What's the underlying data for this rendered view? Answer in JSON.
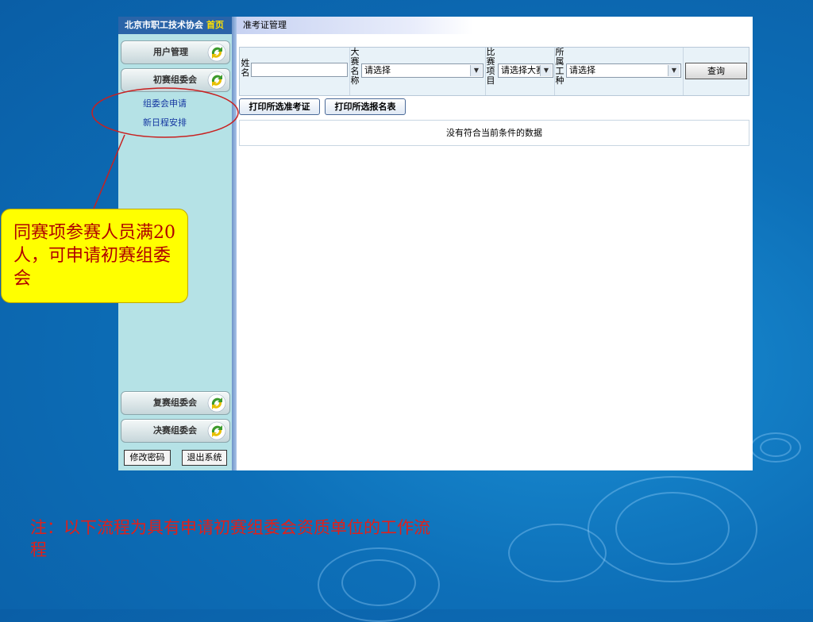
{
  "sidebar": {
    "org_name": "北京市职工技术协会",
    "home_link": "首页",
    "menus": [
      {
        "label": "用户管理"
      },
      {
        "label": "初赛组委会"
      },
      {
        "label": "复赛组委会"
      },
      {
        "label": "决赛组委会"
      }
    ],
    "sub_links": [
      {
        "label": "组委会申请"
      },
      {
        "label": "新日程安排"
      }
    ],
    "change_password": "修改密码",
    "logout": "退出系统"
  },
  "content": {
    "title": "准考证管理",
    "filters": {
      "name_label": "姓名",
      "competition_label": "大赛名称",
      "competition_value": "请选择",
      "event_label": "比赛项目",
      "event_value": "请选择大赛",
      "trade_label": "所属工种",
      "trade_value": "请选择",
      "query_button": "查询"
    },
    "print_admission_button": "打印所选准考证",
    "print_registration_button": "打印所选报名表",
    "empty_message": "没有符合当前条件的数据"
  },
  "annotations": {
    "callout": "同赛项参赛人员满20人，可申请初赛组委会",
    "note": "注：以下流程为具有申请初赛组委会资质单位的工作流程"
  },
  "colors": {
    "callout_bg": "#ffff00",
    "callout_text": "#b00000",
    "note_text": "#e0201a",
    "sidebar_bg": "#b5e2e6",
    "header_bg": "#2a64a8"
  }
}
